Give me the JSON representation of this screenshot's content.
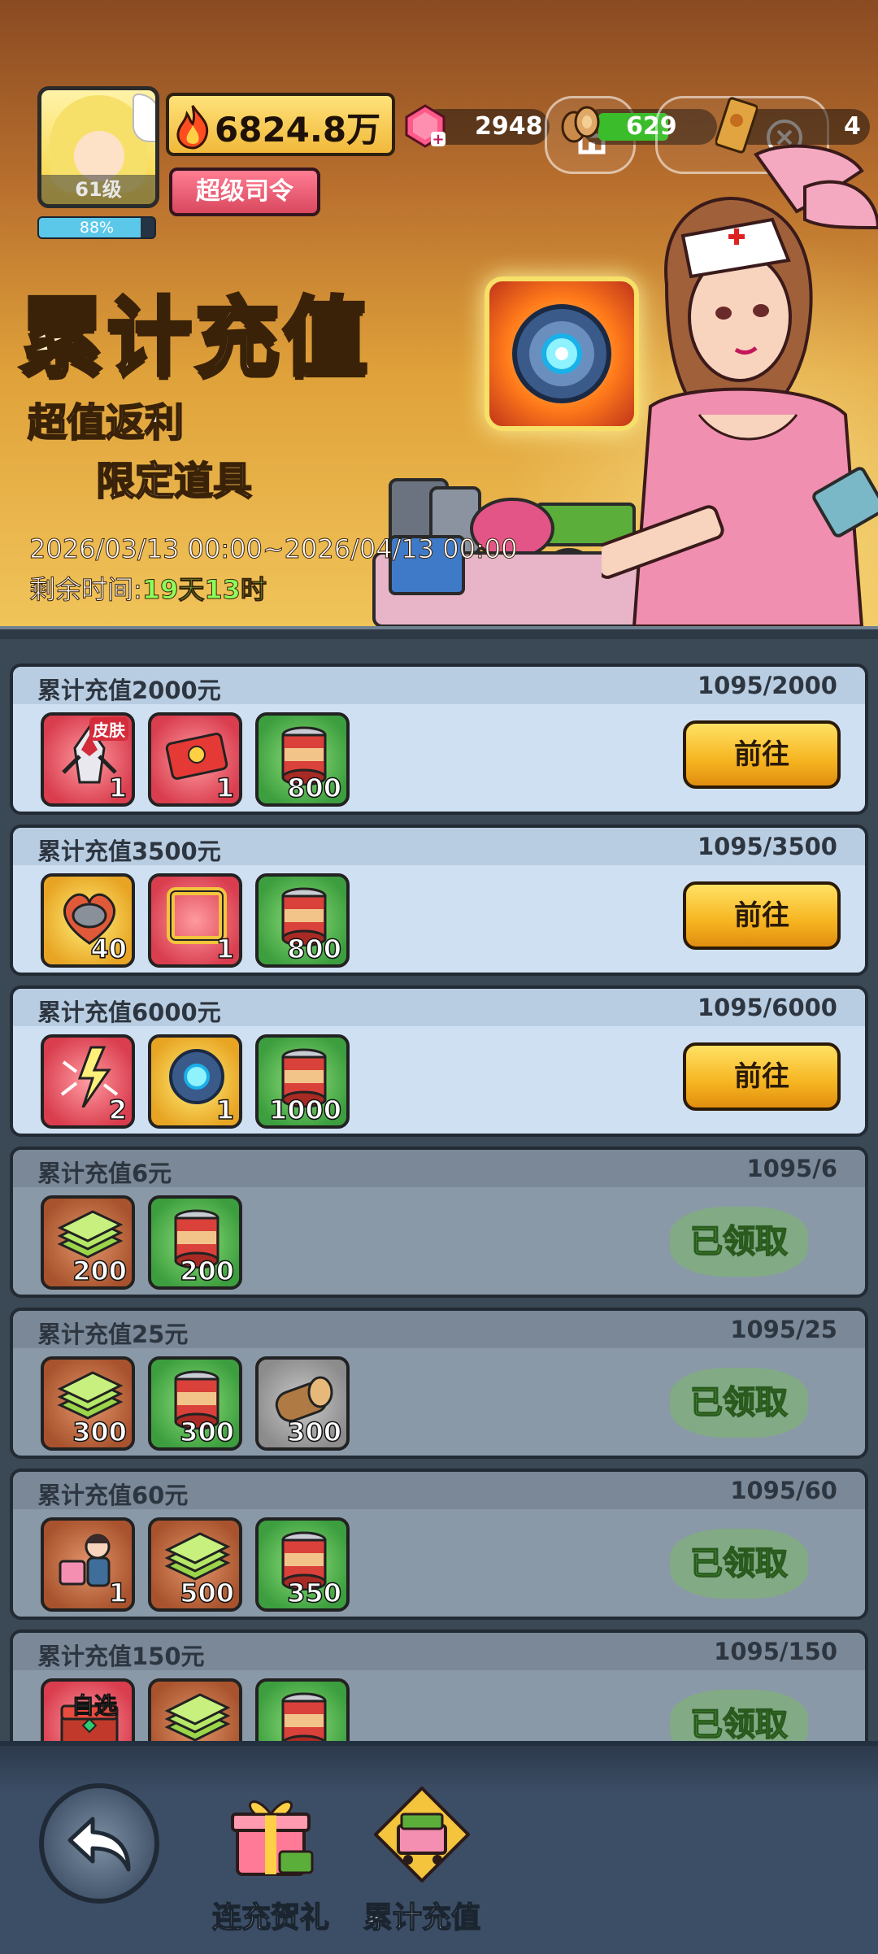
{
  "header": {
    "level": "61级",
    "exp_percent": "88%",
    "exp_fraction": 0.88,
    "power": "6824.8万",
    "title_badge": "超级司令",
    "gems": "2948",
    "wood": "629",
    "tickets": "4"
  },
  "banner": {
    "title": "累计充值",
    "subtitle1": "超值返利",
    "subtitle2": "限定道具",
    "period": "2026/03/13  00:00~2026/04/13  00:00",
    "remain_label": "剩余时间:",
    "remain_value": "19天13时"
  },
  "go_label": "前往",
  "claimed_label": "已领取",
  "tiers": [
    {
      "title": "累计充值2000元",
      "progress": "1095/2000",
      "state": "go",
      "items": [
        {
          "icon": "mecha-skin-icon",
          "color": "red",
          "count": "1",
          "tag": "皮肤"
        },
        {
          "icon": "red-ticket-icon",
          "color": "red",
          "count": "1"
        },
        {
          "icon": "can-icon",
          "color": "green",
          "count": "800"
        }
      ]
    },
    {
      "title": "累计充值3500元",
      "progress": "1095/3500",
      "state": "go",
      "items": [
        {
          "icon": "helmet-heart-icon",
          "color": "gold",
          "count": "40"
        },
        {
          "icon": "gold-frame-icon",
          "color": "red",
          "count": "1"
        },
        {
          "icon": "can-icon",
          "color": "green",
          "count": "800"
        }
      ]
    },
    {
      "title": "累计充值6000元",
      "progress": "1095/6000",
      "state": "go",
      "items": [
        {
          "icon": "lightning-burst-icon",
          "color": "red",
          "count": "2"
        },
        {
          "icon": "core-orb-icon",
          "color": "gold",
          "count": "1"
        },
        {
          "icon": "can-icon",
          "color": "green",
          "count": "1000"
        }
      ]
    },
    {
      "title": "累计充值6元",
      "progress": "1095/6",
      "state": "claimed",
      "items": [
        {
          "icon": "cash-stack-icon",
          "color": "brown",
          "count": "200"
        },
        {
          "icon": "can-icon",
          "color": "green",
          "count": "200"
        }
      ]
    },
    {
      "title": "累计充值25元",
      "progress": "1095/25",
      "state": "claimed",
      "items": [
        {
          "icon": "cash-stack-icon",
          "color": "brown",
          "count": "300"
        },
        {
          "icon": "can-icon",
          "color": "green",
          "count": "300"
        },
        {
          "icon": "wood-log-icon",
          "color": "gray",
          "count": "300"
        }
      ]
    },
    {
      "title": "累计充值60元",
      "progress": "1095/60",
      "state": "claimed",
      "items": [
        {
          "icon": "survivor-girl-icon",
          "color": "brown",
          "count": "1"
        },
        {
          "icon": "cash-stack-icon",
          "color": "brown",
          "count": "500"
        },
        {
          "icon": "can-icon",
          "color": "green",
          "count": "350"
        }
      ]
    },
    {
      "title": "累计充值150元",
      "progress": "1095/150",
      "state": "claimed",
      "items": [
        {
          "icon": "select-chest-icon",
          "color": "red",
          "count": "",
          "tag": "自选"
        },
        {
          "icon": "cash-stack-icon",
          "color": "brown",
          "count": ""
        },
        {
          "icon": "can-icon",
          "color": "green",
          "count": ""
        }
      ]
    }
  ],
  "nav": {
    "tab1": "连充贺礼",
    "tab2": "累计充值"
  },
  "colors": {
    "accent_gold": "#f6b420",
    "claimed_green": "#5fd04a",
    "card_active": "#cfe0f2",
    "card_done": "#8a99a8"
  }
}
